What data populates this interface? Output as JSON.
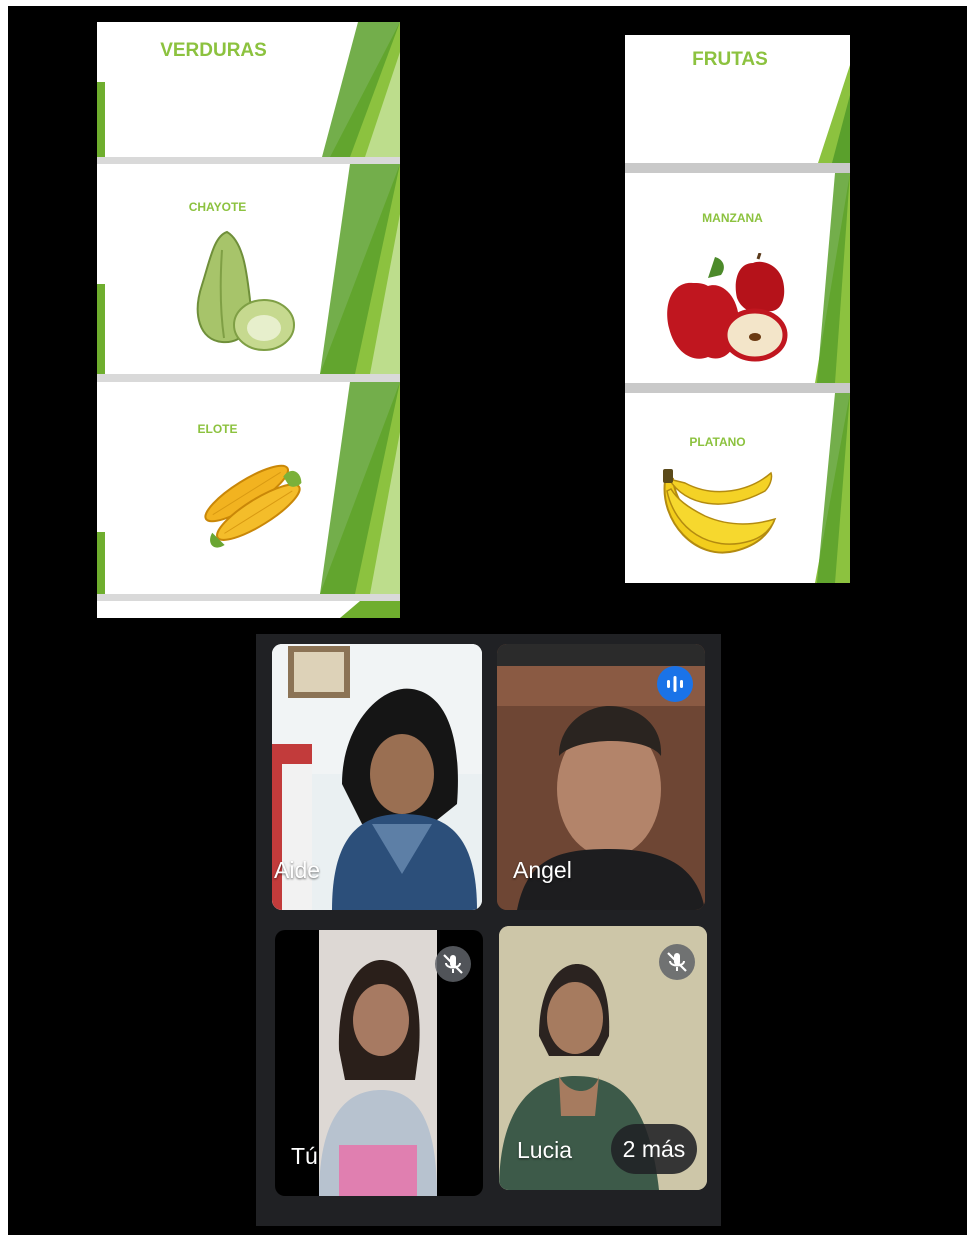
{
  "slides_left": {
    "header": "VERDURAS",
    "items": [
      {
        "label": "CHAYOTE",
        "image": "chayote-image"
      },
      {
        "label": "ELOTE",
        "image": "corn-image"
      }
    ]
  },
  "slides_right": {
    "header": "FRUTAS",
    "items": [
      {
        "label": "MANZANA",
        "image": "apple-image"
      },
      {
        "label": "PLATANO",
        "image": "banana-image"
      }
    ]
  },
  "meeting": {
    "participants": [
      {
        "name": "Aide",
        "indicator": "none"
      },
      {
        "name": "Angel",
        "indicator": "speaking-icon"
      },
      {
        "name": "Tú",
        "indicator": "mic-off-icon"
      },
      {
        "name": "Lucia",
        "indicator": "mic-off-icon"
      }
    ],
    "overflow_label": "2 más"
  },
  "colors": {
    "slide_green": "#8cc23f",
    "slide_dark_green": "#4f9a2a",
    "meet_background": "#202124",
    "speaking_blue": "#1a73e8"
  }
}
